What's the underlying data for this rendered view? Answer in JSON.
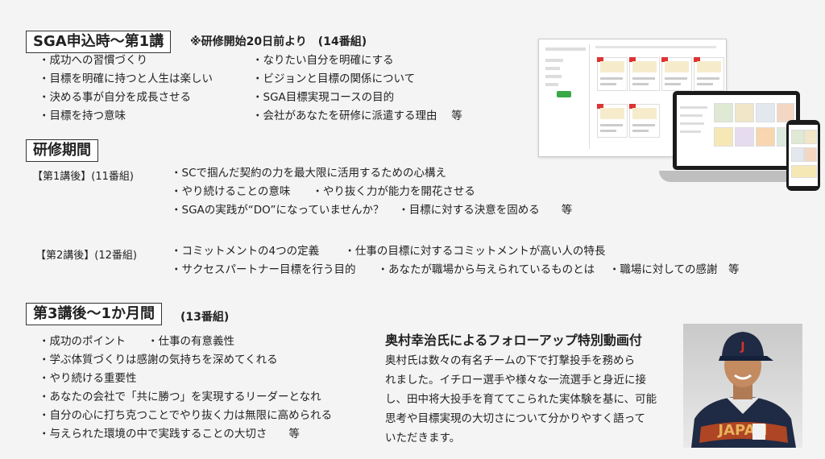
{
  "section1": {
    "title": "SGA申込時～第1講",
    "note": "※研修開始20日前より　(14番組)",
    "left_items": [
      "・成功への習慣づくり",
      "・目標を明確に持つと人生は楽しい",
      "・決める事が自分を成長させる",
      "・目標を持つ意味"
    ],
    "right_items": [
      "・なりたい自分を明確にする",
      "・ビジョンと目標の関係について",
      "・SGA目標実現コースの目的",
      "・会社があなたを研修に派遣する理由　 等"
    ]
  },
  "section2": {
    "title": "研修期間",
    "group1_label": "【第1講後】(11番組)",
    "group1_lines": [
      "・SCで掴んだ契約の力を最大限に活用するための心構え",
      "・やり続けることの意味　　・やり抜く力が能力を開花させる",
      "・SGAの実践が“DO”になっていませんか？　 ・目標に対する決意を固める　　等"
    ],
    "group2_label": "【第2講後】(12番組)",
    "group2_lines": [
      "・コミットメントの4つの定義　　 ・仕事の目標に対するコミットメントが高い人の特長",
      "・サクセスパートナー目標を行う目的　　・あなたが職場から与えられているものとは　 ・職場に対しての感謝　等"
    ]
  },
  "section3": {
    "title": "第3講後～1か月間",
    "note": "(13番組)",
    "items": [
      "・成功のポイント　　・仕事の有意義性",
      "・学ぶ体質づくりは感謝の気持ちを深めてくれる",
      "・やり続ける重要性",
      "・あなたの会社で「共に勝つ」を実現するリーダーとなれ",
      "・自分の心に打ち克つことでやり抜く力は無限に高められる",
      "・与えられた環境の中で実践することの大切さ　　等"
    ]
  },
  "followup": {
    "heading": "奥村幸治氏によるフォローアップ特別動画付",
    "lines": [
      "奥村氏は数々の有名チームの下で打撃投手を務めら",
      "れました。イチロー選手や様々な一流選手と身近に接",
      "し、田中将大投手を育ててこられた実体験を基に、可能",
      "思考や目標実現の大切さについて分かりやすく語って",
      "いただきます。"
    ],
    "cap_letter": "J",
    "jersey_text": "JAPAN"
  },
  "colors": {
    "accent_green": "#39a845",
    "card_tag": "#d33333",
    "cap_navy": "#1f2a44"
  }
}
